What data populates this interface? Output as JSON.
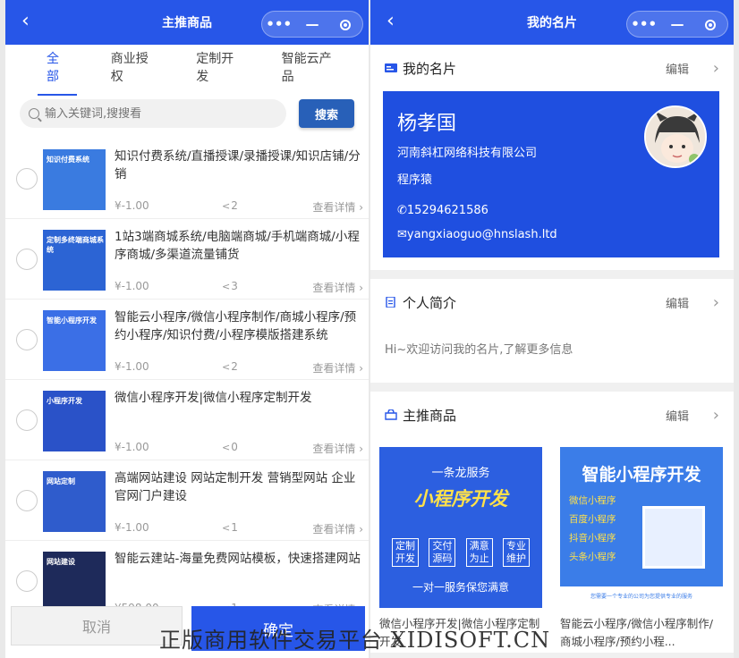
{
  "left": {
    "nav": {
      "title": "主推商品",
      "back": "‹"
    },
    "tabs": [
      "全部",
      "商业授权",
      "定制开发",
      "智能云产品"
    ],
    "search": {
      "placeholder": "输入关键词,搜搜看",
      "button": "搜索"
    },
    "items": [
      {
        "title": "知识付费系统/直播授课/录播授课/知识店铺/分销",
        "price": "¥-1.00",
        "shares": "2",
        "detail": "查看详情 ›",
        "thumb_text": "知识付费系统",
        "thumb_color": "#3a7be0"
      },
      {
        "title": "1站3端商城系统/电脑端商城/手机端商城/小程序商城/多渠道流量铺货",
        "price": "¥-1.00",
        "shares": "3",
        "detail": "查看详情 ›",
        "thumb_text": "定制多终端商城系统",
        "thumb_color": "#2c64d4"
      },
      {
        "title": "智能云小程序/微信小程序制作/商城小程序/预约小程序/知识付费/小程序模版搭建系统",
        "price": "¥-1.00",
        "shares": "2",
        "detail": "查看详情 ›",
        "thumb_text": "智能小程序开发",
        "thumb_color": "#3b6fe6"
      },
      {
        "title": "微信小程序开发|微信小程序定制开发",
        "price": "¥-1.00",
        "shares": "0",
        "detail": "查看详情 ›",
        "thumb_text": "小程序开发",
        "thumb_color": "#2a52c8"
      },
      {
        "title": "高端网站建设 网站定制开发 营销型网站 企业官网门户建设",
        "price": "¥-1.00",
        "shares": "1",
        "detail": "查看详情 ›",
        "thumb_text": "网站定制",
        "thumb_color": "#2f5ccc"
      },
      {
        "title": "智能云建站-海量免费网站模板，快速搭建网站",
        "price": "¥598.00",
        "shares": "1",
        "detail": "查看详情 ›",
        "thumb_text": "网站建设",
        "thumb_color": "#1e2a5a"
      }
    ],
    "footer": {
      "cancel": "取消",
      "ok": "确定"
    }
  },
  "right": {
    "nav": {
      "title": "我的名片",
      "back": "‹"
    },
    "card_section": {
      "title": "我的名片",
      "edit": "编辑"
    },
    "card": {
      "name": "杨孝国",
      "company": "河南斜杠网络科技有限公司",
      "role": "程序猿",
      "phone": "15294621586",
      "email": "yangxiaoguo@hnslash.ltd"
    },
    "intro_section": {
      "title": "个人简介",
      "edit": "编辑",
      "text": "Hi~欢迎访问我的名片,了解更多信息"
    },
    "products_section": {
      "title": "主推商品",
      "edit": "编辑"
    },
    "products": [
      {
        "name": "微信小程序开发|微信小程序定制开发",
        "img_top": "一条龙服务",
        "img_main": "小程序开发",
        "img_tags": [
          "定制开发",
          "交付源码",
          "满意为止",
          "专业维护"
        ],
        "img_bottom": "一对一服务保您满意"
      },
      {
        "name": "智能云小程序/微信小程序制作/商城小程序/预约小程...",
        "img_main": "智能小程序开发",
        "img_list": [
          "微信小程序",
          "百度小程序",
          "抖音小程序",
          "头条小程序"
        ],
        "img_bottom": "您需要一个专业的公司为您提供专业的服务"
      }
    ]
  },
  "watermark": "正版商用软件交易平台 XIDISOFT.CN",
  "colors": {
    "primary": "#2756e8",
    "search_button": "#2860b8"
  }
}
